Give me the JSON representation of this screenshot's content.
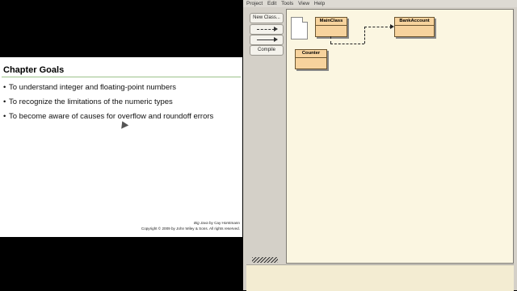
{
  "slide": {
    "title": "Chapter Goals",
    "bullets": [
      "To understand integer and floating-point numbers",
      "To recognize the limitations of the numeric types",
      "To become aware of causes for overflow and roundoff errors"
    ],
    "credit_book": "Big Java",
    "credit_author": " by Cay Horstmann",
    "credit_copyright": "Copyright © 2009 by John Wiley & Sons.  All rights reserved."
  },
  "ide": {
    "menu": [
      "Project",
      "Edit",
      "Tools",
      "View",
      "Help"
    ],
    "toolbar": {
      "new_class": "New Class...",
      "compile": "Compile"
    },
    "classes": [
      "MainClass",
      "BankAccount",
      "Counter"
    ]
  }
}
